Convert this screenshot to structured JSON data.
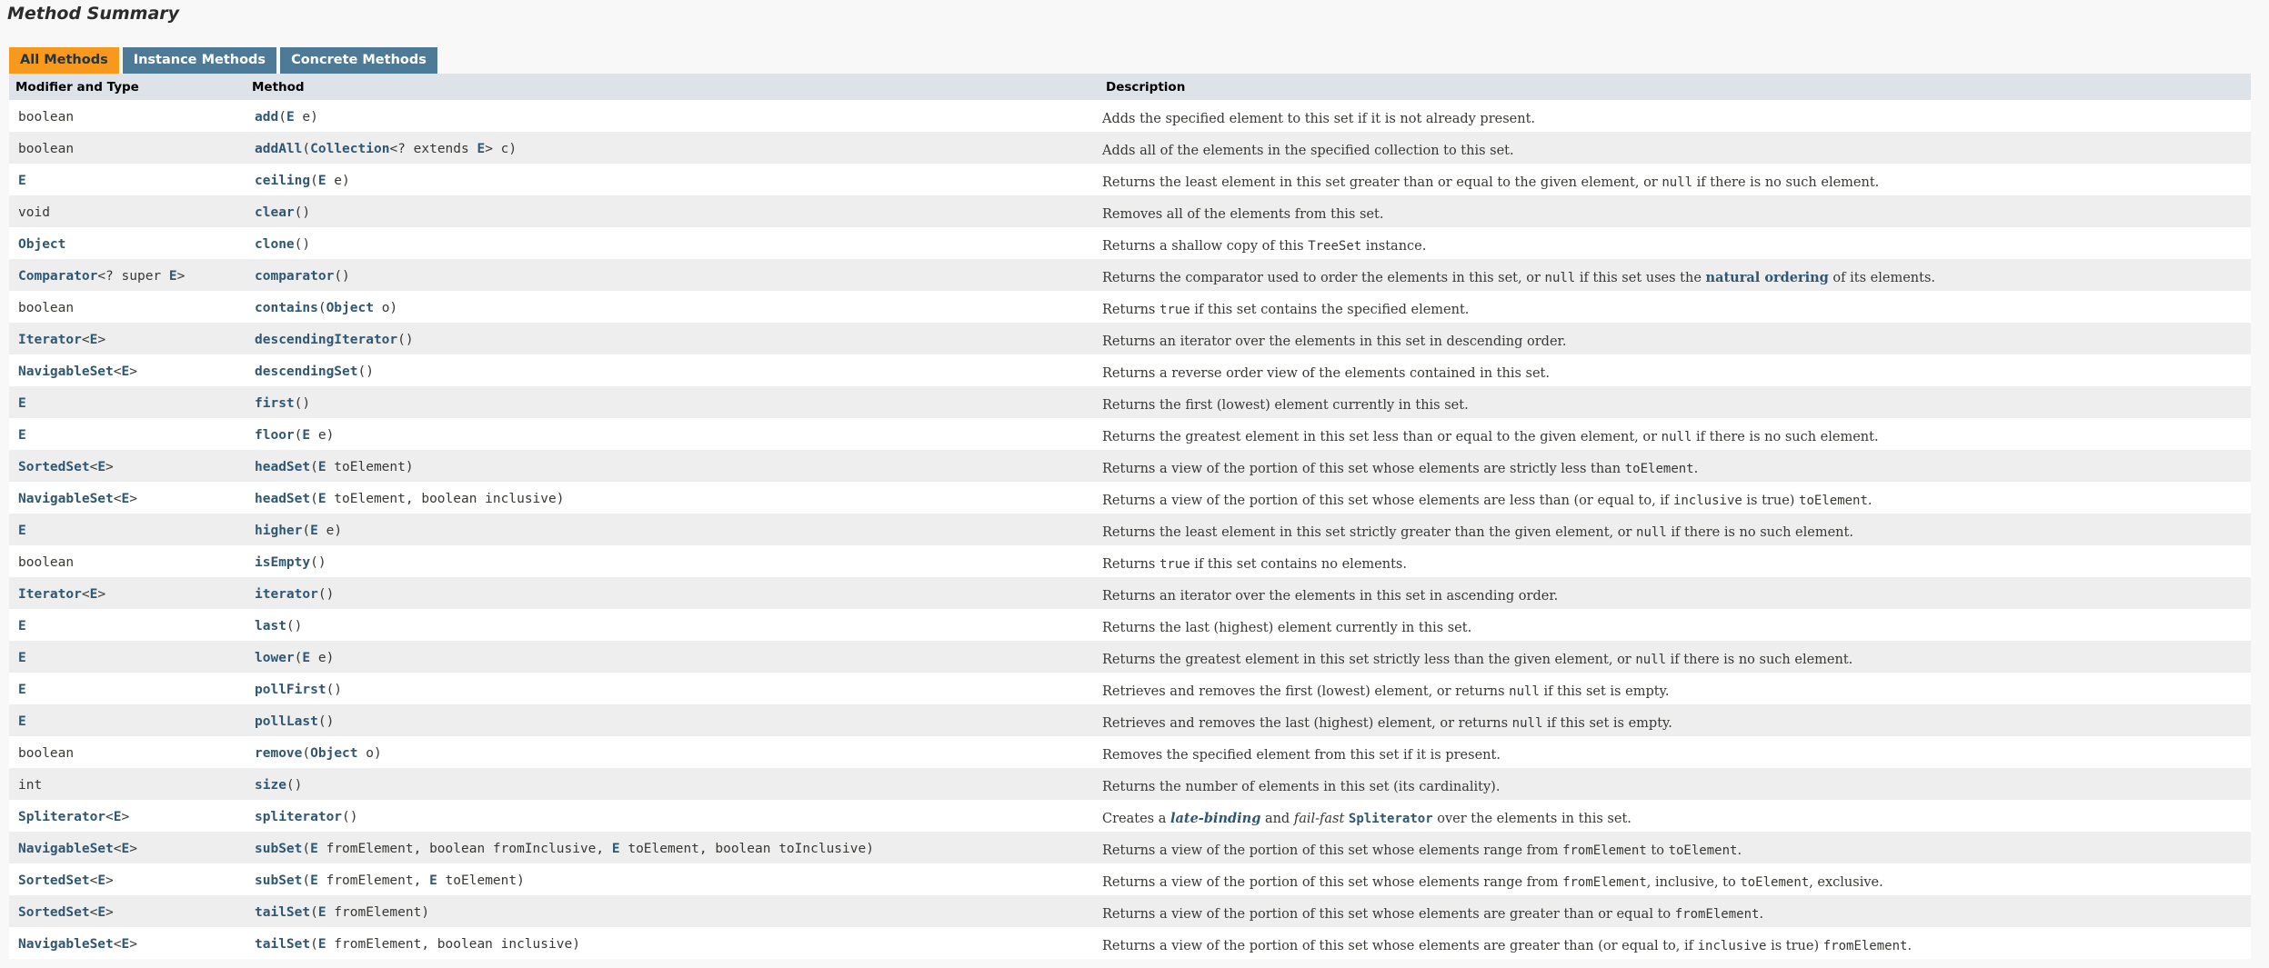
{
  "section_title": "Method Summary",
  "tabs": [
    "All Methods",
    "Instance Methods",
    "Concrete Methods"
  ],
  "headers": {
    "type": "Modifier and Type",
    "method": "Method",
    "description": "Description"
  },
  "rows": [
    {
      "type": [
        [
          "boolean",
          "p"
        ]
      ],
      "method": [
        [
          "add",
          "m"
        ],
        [
          "(",
          "p"
        ],
        [
          "E",
          "l"
        ],
        [
          " e)",
          "p"
        ]
      ],
      "desc": [
        [
          "Adds the specified element to this set if it is not already present.",
          "t"
        ]
      ]
    },
    {
      "type": [
        [
          "boolean",
          "p"
        ]
      ],
      "method": [
        [
          "addAll",
          "m"
        ],
        [
          "(",
          "p"
        ],
        [
          "Collection",
          "l"
        ],
        [
          "<? extends ",
          "p"
        ],
        [
          "E",
          "l"
        ],
        [
          "> c)",
          "p"
        ]
      ],
      "desc": [
        [
          "Adds all of the elements in the specified collection to this set.",
          "t"
        ]
      ]
    },
    {
      "type": [
        [
          "E",
          "l"
        ]
      ],
      "method": [
        [
          "ceiling",
          "m"
        ],
        [
          "(",
          "p"
        ],
        [
          "E",
          "l"
        ],
        [
          " e)",
          "p"
        ]
      ],
      "desc": [
        [
          "Returns the least element in this set greater than or equal to the given element, or ",
          "t"
        ],
        [
          "null",
          "c"
        ],
        [
          " if there is no such element.",
          "t"
        ]
      ]
    },
    {
      "type": [
        [
          "void",
          "p"
        ]
      ],
      "method": [
        [
          "clear",
          "m"
        ],
        [
          "()",
          "p"
        ]
      ],
      "desc": [
        [
          "Removes all of the elements from this set.",
          "t"
        ]
      ]
    },
    {
      "type": [
        [
          "Object",
          "l"
        ]
      ],
      "method": [
        [
          "clone",
          "m"
        ],
        [
          "()",
          "p"
        ]
      ],
      "desc": [
        [
          "Returns a shallow copy of this ",
          "t"
        ],
        [
          "TreeSet",
          "c"
        ],
        [
          " instance.",
          "t"
        ]
      ]
    },
    {
      "type": [
        [
          "Comparator",
          "l"
        ],
        [
          "<? super ",
          "p"
        ],
        [
          "E",
          "l"
        ],
        [
          ">",
          "p"
        ]
      ],
      "method": [
        [
          "comparator",
          "m"
        ],
        [
          "()",
          "p"
        ]
      ],
      "desc": [
        [
          "Returns the comparator used to order the elements in this set, or ",
          "t"
        ],
        [
          "null",
          "c"
        ],
        [
          " if this set uses the ",
          "t"
        ],
        [
          "natural ordering",
          "k"
        ],
        [
          " of its elements.",
          "t"
        ]
      ]
    },
    {
      "type": [
        [
          "boolean",
          "p"
        ]
      ],
      "method": [
        [
          "contains",
          "m"
        ],
        [
          "(",
          "p"
        ],
        [
          "Object",
          "l"
        ],
        [
          " o)",
          "p"
        ]
      ],
      "desc": [
        [
          "Returns ",
          "t"
        ],
        [
          "true",
          "c"
        ],
        [
          " if this set contains the specified element.",
          "t"
        ]
      ]
    },
    {
      "type": [
        [
          "Iterator",
          "l"
        ],
        [
          "<",
          "p"
        ],
        [
          "E",
          "l"
        ],
        [
          ">",
          "p"
        ]
      ],
      "method": [
        [
          "descendingIterator",
          "m"
        ],
        [
          "()",
          "p"
        ]
      ],
      "desc": [
        [
          "Returns an iterator over the elements in this set in descending order.",
          "t"
        ]
      ]
    },
    {
      "type": [
        [
          "NavigableSet",
          "l"
        ],
        [
          "<",
          "p"
        ],
        [
          "E",
          "l"
        ],
        [
          ">",
          "p"
        ]
      ],
      "method": [
        [
          "descendingSet",
          "m"
        ],
        [
          "()",
          "p"
        ]
      ],
      "desc": [
        [
          "Returns a reverse order view of the elements contained in this set.",
          "t"
        ]
      ]
    },
    {
      "type": [
        [
          "E",
          "l"
        ]
      ],
      "method": [
        [
          "first",
          "m"
        ],
        [
          "()",
          "p"
        ]
      ],
      "desc": [
        [
          "Returns the first (lowest) element currently in this set.",
          "t"
        ]
      ]
    },
    {
      "type": [
        [
          "E",
          "l"
        ]
      ],
      "method": [
        [
          "floor",
          "m"
        ],
        [
          "(",
          "p"
        ],
        [
          "E",
          "l"
        ],
        [
          " e)",
          "p"
        ]
      ],
      "desc": [
        [
          "Returns the greatest element in this set less than or equal to the given element, or ",
          "t"
        ],
        [
          "null",
          "c"
        ],
        [
          " if there is no such element.",
          "t"
        ]
      ]
    },
    {
      "type": [
        [
          "SortedSet",
          "l"
        ],
        [
          "<",
          "p"
        ],
        [
          "E",
          "l"
        ],
        [
          ">",
          "p"
        ]
      ],
      "method": [
        [
          "headSet",
          "m"
        ],
        [
          "(",
          "p"
        ],
        [
          "E",
          "l"
        ],
        [
          " toElement)",
          "p"
        ]
      ],
      "desc": [
        [
          "Returns a view of the portion of this set whose elements are strictly less than ",
          "t"
        ],
        [
          "toElement",
          "c"
        ],
        [
          ".",
          "t"
        ]
      ]
    },
    {
      "type": [
        [
          "NavigableSet",
          "l"
        ],
        [
          "<",
          "p"
        ],
        [
          "E",
          "l"
        ],
        [
          ">",
          "p"
        ]
      ],
      "method": [
        [
          "headSet",
          "m"
        ],
        [
          "(",
          "p"
        ],
        [
          "E",
          "l"
        ],
        [
          " toElement, boolean inclusive)",
          "p"
        ]
      ],
      "desc": [
        [
          "Returns a view of the portion of this set whose elements are less than (or equal to, if ",
          "t"
        ],
        [
          "inclusive",
          "c"
        ],
        [
          " is true) ",
          "t"
        ],
        [
          "toElement",
          "c"
        ],
        [
          ".",
          "t"
        ]
      ]
    },
    {
      "type": [
        [
          "E",
          "l"
        ]
      ],
      "method": [
        [
          "higher",
          "m"
        ],
        [
          "(",
          "p"
        ],
        [
          "E",
          "l"
        ],
        [
          " e)",
          "p"
        ]
      ],
      "desc": [
        [
          "Returns the least element in this set strictly greater than the given element, or ",
          "t"
        ],
        [
          "null",
          "c"
        ],
        [
          " if there is no such element.",
          "t"
        ]
      ]
    },
    {
      "type": [
        [
          "boolean",
          "p"
        ]
      ],
      "method": [
        [
          "isEmpty",
          "m"
        ],
        [
          "()",
          "p"
        ]
      ],
      "desc": [
        [
          "Returns ",
          "t"
        ],
        [
          "true",
          "c"
        ],
        [
          " if this set contains no elements.",
          "t"
        ]
      ]
    },
    {
      "type": [
        [
          "Iterator",
          "l"
        ],
        [
          "<",
          "p"
        ],
        [
          "E",
          "l"
        ],
        [
          ">",
          "p"
        ]
      ],
      "method": [
        [
          "iterator",
          "m"
        ],
        [
          "()",
          "p"
        ]
      ],
      "desc": [
        [
          "Returns an iterator over the elements in this set in ascending order.",
          "t"
        ]
      ]
    },
    {
      "type": [
        [
          "E",
          "l"
        ]
      ],
      "method": [
        [
          "last",
          "m"
        ],
        [
          "()",
          "p"
        ]
      ],
      "desc": [
        [
          "Returns the last (highest) element currently in this set.",
          "t"
        ]
      ]
    },
    {
      "type": [
        [
          "E",
          "l"
        ]
      ],
      "method": [
        [
          "lower",
          "m"
        ],
        [
          "(",
          "p"
        ],
        [
          "E",
          "l"
        ],
        [
          " e)",
          "p"
        ]
      ],
      "desc": [
        [
          "Returns the greatest element in this set strictly less than the given element, or ",
          "t"
        ],
        [
          "null",
          "c"
        ],
        [
          " if there is no such element.",
          "t"
        ]
      ]
    },
    {
      "type": [
        [
          "E",
          "l"
        ]
      ],
      "method": [
        [
          "pollFirst",
          "m"
        ],
        [
          "()",
          "p"
        ]
      ],
      "desc": [
        [
          "Retrieves and removes the first (lowest) element, or returns ",
          "t"
        ],
        [
          "null",
          "c"
        ],
        [
          " if this set is empty.",
          "t"
        ]
      ]
    },
    {
      "type": [
        [
          "E",
          "l"
        ]
      ],
      "method": [
        [
          "pollLast",
          "m"
        ],
        [
          "()",
          "p"
        ]
      ],
      "desc": [
        [
          "Retrieves and removes the last (highest) element, or returns ",
          "t"
        ],
        [
          "null",
          "c"
        ],
        [
          " if this set is empty.",
          "t"
        ]
      ]
    },
    {
      "type": [
        [
          "boolean",
          "p"
        ]
      ],
      "method": [
        [
          "remove",
          "m"
        ],
        [
          "(",
          "p"
        ],
        [
          "Object",
          "l"
        ],
        [
          " o)",
          "p"
        ]
      ],
      "desc": [
        [
          "Removes the specified element from this set if it is present.",
          "t"
        ]
      ]
    },
    {
      "type": [
        [
          "int",
          "p"
        ]
      ],
      "method": [
        [
          "size",
          "m"
        ],
        [
          "()",
          "p"
        ]
      ],
      "desc": [
        [
          "Returns the number of elements in this set (its cardinality).",
          "t"
        ]
      ]
    },
    {
      "type": [
        [
          "Spliterator",
          "l"
        ],
        [
          "<",
          "p"
        ],
        [
          "E",
          "l"
        ],
        [
          ">",
          "p"
        ]
      ],
      "method": [
        [
          "spliterator",
          "m"
        ],
        [
          "()",
          "p"
        ]
      ],
      "desc": [
        [
          "Creates a ",
          "t"
        ],
        [
          "late-binding",
          "e"
        ],
        [
          " and ",
          "t"
        ],
        [
          "fail-fast",
          "i"
        ],
        [
          " ",
          "t"
        ],
        [
          "Spliterator",
          "n"
        ],
        [
          " over the elements in this set.",
          "t"
        ]
      ]
    },
    {
      "type": [
        [
          "NavigableSet",
          "l"
        ],
        [
          "<",
          "p"
        ],
        [
          "E",
          "l"
        ],
        [
          ">",
          "p"
        ]
      ],
      "method": [
        [
          "subSet",
          "m"
        ],
        [
          "(",
          "p"
        ],
        [
          "E",
          "l"
        ],
        [
          " fromElement, boolean fromInclusive, ",
          "p"
        ],
        [
          "E",
          "l"
        ],
        [
          " toElement, boolean toInclusive)",
          "p"
        ]
      ],
      "desc": [
        [
          "Returns a view of the portion of this set whose elements range from ",
          "t"
        ],
        [
          "fromElement",
          "c"
        ],
        [
          " to ",
          "t"
        ],
        [
          "toElement",
          "c"
        ],
        [
          ".",
          "t"
        ]
      ]
    },
    {
      "type": [
        [
          "SortedSet",
          "l"
        ],
        [
          "<",
          "p"
        ],
        [
          "E",
          "l"
        ],
        [
          ">",
          "p"
        ]
      ],
      "method": [
        [
          "subSet",
          "m"
        ],
        [
          "(",
          "p"
        ],
        [
          "E",
          "l"
        ],
        [
          " fromElement, ",
          "p"
        ],
        [
          "E",
          "l"
        ],
        [
          " toElement)",
          "p"
        ]
      ],
      "desc": [
        [
          "Returns a view of the portion of this set whose elements range from ",
          "t"
        ],
        [
          "fromElement",
          "c"
        ],
        [
          ", inclusive, to ",
          "t"
        ],
        [
          "toElement",
          "c"
        ],
        [
          ", exclusive.",
          "t"
        ]
      ]
    },
    {
      "type": [
        [
          "SortedSet",
          "l"
        ],
        [
          "<",
          "p"
        ],
        [
          "E",
          "l"
        ],
        [
          ">",
          "p"
        ]
      ],
      "method": [
        [
          "tailSet",
          "m"
        ],
        [
          "(",
          "p"
        ],
        [
          "E",
          "l"
        ],
        [
          " fromElement)",
          "p"
        ]
      ],
      "desc": [
        [
          "Returns a view of the portion of this set whose elements are greater than or equal to ",
          "t"
        ],
        [
          "fromElement",
          "c"
        ],
        [
          ".",
          "t"
        ]
      ]
    },
    {
      "type": [
        [
          "NavigableSet",
          "l"
        ],
        [
          "<",
          "p"
        ],
        [
          "E",
          "l"
        ],
        [
          ">",
          "p"
        ]
      ],
      "method": [
        [
          "tailSet",
          "m"
        ],
        [
          "(",
          "p"
        ],
        [
          "E",
          "l"
        ],
        [
          " fromElement, boolean inclusive)",
          "p"
        ]
      ],
      "desc": [
        [
          "Returns a view of the portion of this set whose elements are greater than (or equal to, if ",
          "t"
        ],
        [
          "inclusive",
          "c"
        ],
        [
          " is true) ",
          "t"
        ],
        [
          "fromElement",
          "c"
        ],
        [
          ".",
          "t"
        ]
      ]
    }
  ]
}
